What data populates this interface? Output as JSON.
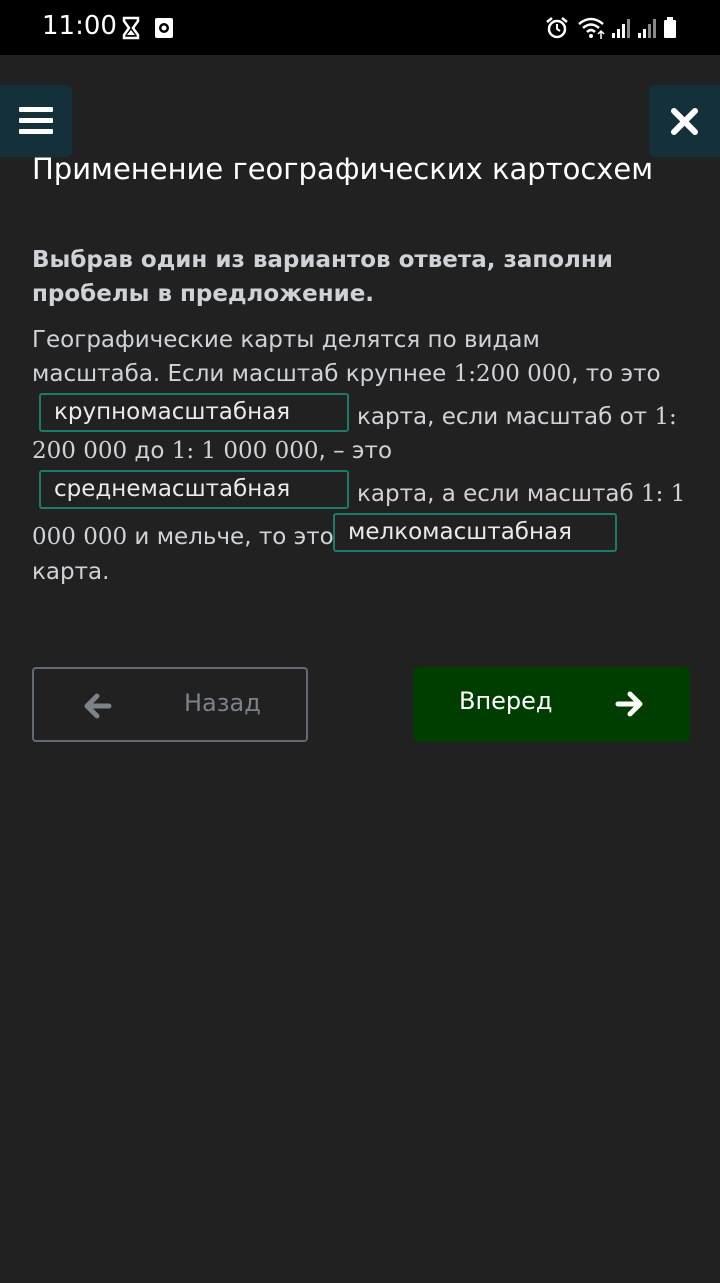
{
  "status_bar": {
    "time": "11:00",
    "left_icons": [
      "hourglass-icon",
      "screen-record-icon"
    ],
    "right_icons": [
      "alarm-icon",
      "wifi-icon",
      "signal-icon",
      "signal-icon",
      "battery-icon"
    ]
  },
  "header": {
    "menu_icon": "hamburger-icon",
    "close_icon": "close-icon",
    "title": "Применение географических картосхем"
  },
  "task": {
    "instruction": "Выбрав один из вариантов ответа, заполни пробелы в предложение.",
    "line1": "Географические карты делятся по видам",
    "line2_text": "масштаба. Если масштаб крупнее ",
    "line2_num": "1:200 000",
    "line2_end": ", то это",
    "blank1": "крупномасштабная",
    "line3_text": "карта, если масштаб от ",
    "line3_num": "1:",
    "line4_num": "200 000",
    "line4_text": " до ",
    "line4_num2": "1: 1 000 000",
    "line4_end": ", – это",
    "blank2": "среднемасштабная",
    "line5_text": "карта, а если масштаб ",
    "line5_num": "1: 1",
    "line6_num": "000 000",
    "line6_text": " и мельче, то это",
    "blank3": "мелкомасштабная",
    "line7": "карта."
  },
  "nav": {
    "back_label": "Назад",
    "back_icon": "arrow-left-icon",
    "next_label": "Вперед",
    "next_icon": "arrow-right-icon"
  },
  "colors": {
    "background": "#212121",
    "status_bar": "#000000",
    "header_button": "#14303a",
    "blank_border": "#1d7a6b",
    "next_button": "#003d00"
  }
}
